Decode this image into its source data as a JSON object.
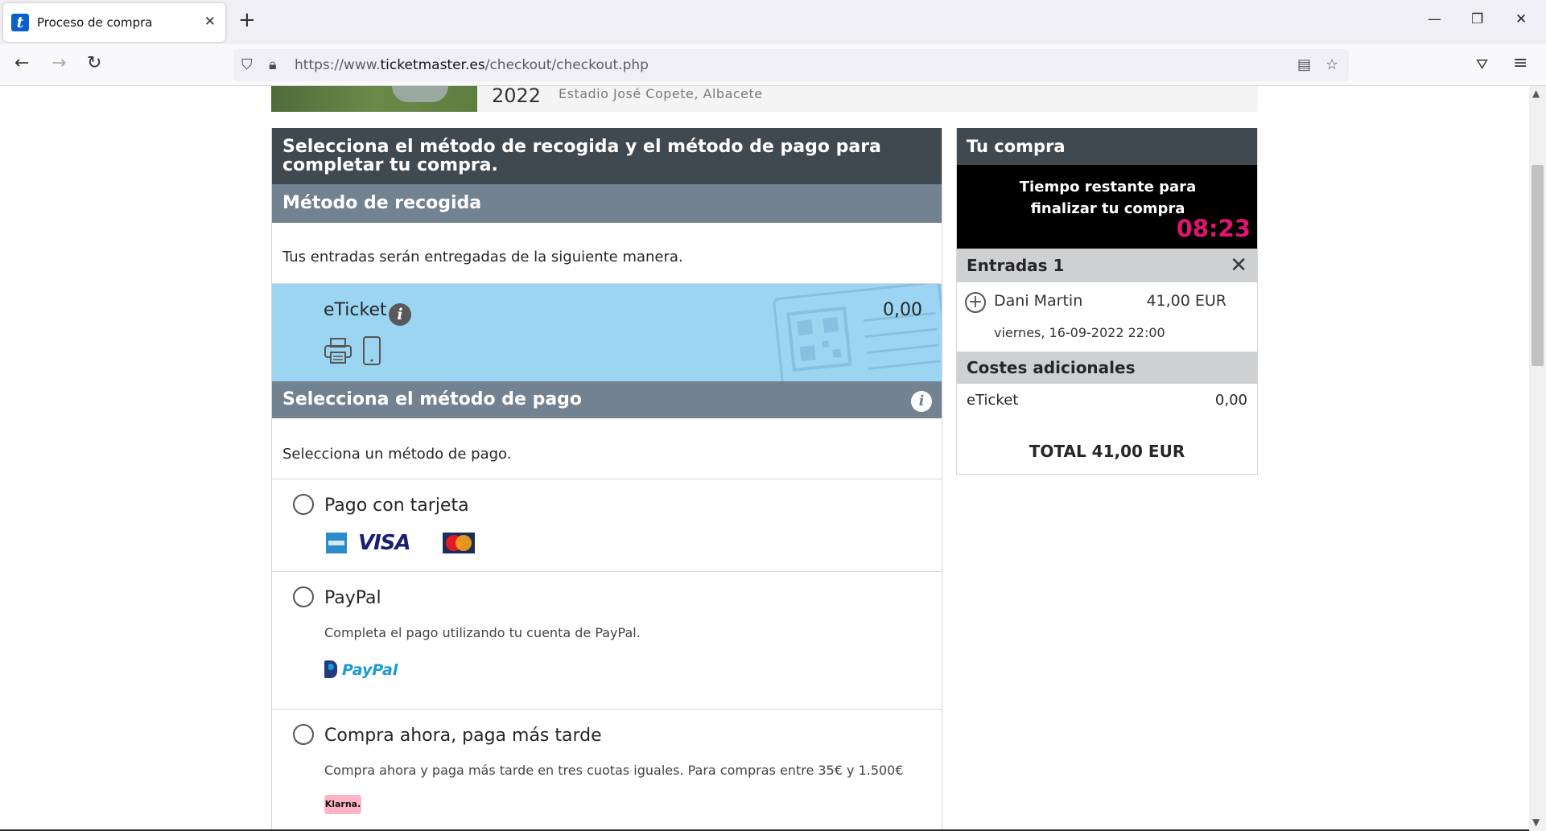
{
  "browser": {
    "tab_title": "Proceso de compra",
    "url_prefix": "https://www.",
    "url_domain": "ticketmaster.es",
    "url_path": "/checkout/checkout.php"
  },
  "event": {
    "year": "2022",
    "venue": "Estadio José Copete, Albacete"
  },
  "checkout": {
    "heading": "Selecciona el método de recogida y el método de pago para completar tu compra.",
    "delivery": {
      "title": "Método de recogida",
      "lead": "Tus entradas serán entregadas de la siguiente manera.",
      "option_name": "eTicket",
      "option_price": "0,00"
    },
    "payment": {
      "title": "Selecciona el método de pago",
      "lead": "Selecciona un método de pago.",
      "options": [
        {
          "title": "Pago con tarjeta",
          "description": ""
        },
        {
          "title": "PayPal",
          "description": "Completa el pago utilizando tu cuenta de PayPal."
        },
        {
          "title": "Compra ahora, paga más tarde",
          "description": "Compra ahora y paga más tarde en tres cuotas iguales. Para compras entre 35€ y 1.500€"
        }
      ],
      "card_brand_visa": "VISA",
      "paypal_logo_a": "Pay",
      "paypal_logo_b": "Pal",
      "klarna_logo": "Klarna."
    }
  },
  "summary": {
    "title": "Tu compra",
    "timer_label": "Tiempo restante para finalizar tu compra",
    "timer_value": "08:23",
    "tickets_header": "Entradas 1",
    "ticket": {
      "name": "Dani Martin",
      "price": "41,00 EUR",
      "date": "viernes, 16-09-2022 22:00"
    },
    "costs_header": "Costes adicionales",
    "cost": {
      "name": "eTicket",
      "value": "0,00"
    },
    "total": "TOTAL 41,00 EUR"
  },
  "colors": {
    "dark_header": "#414950",
    "mid_header": "#738290",
    "eticket_bg": "#9bd5f2",
    "timer_accent": "#e0156e"
  },
  "icons": [
    "close-icon",
    "new-tab-icon",
    "back-icon",
    "forward-icon",
    "reload-icon",
    "shield-icon",
    "lock-icon",
    "reader-icon",
    "bookmark-star-icon",
    "pocket-icon",
    "menu-icon",
    "info-icon",
    "printer-icon",
    "phone-icon",
    "plus-circle-icon",
    "remove-x-icon"
  ]
}
